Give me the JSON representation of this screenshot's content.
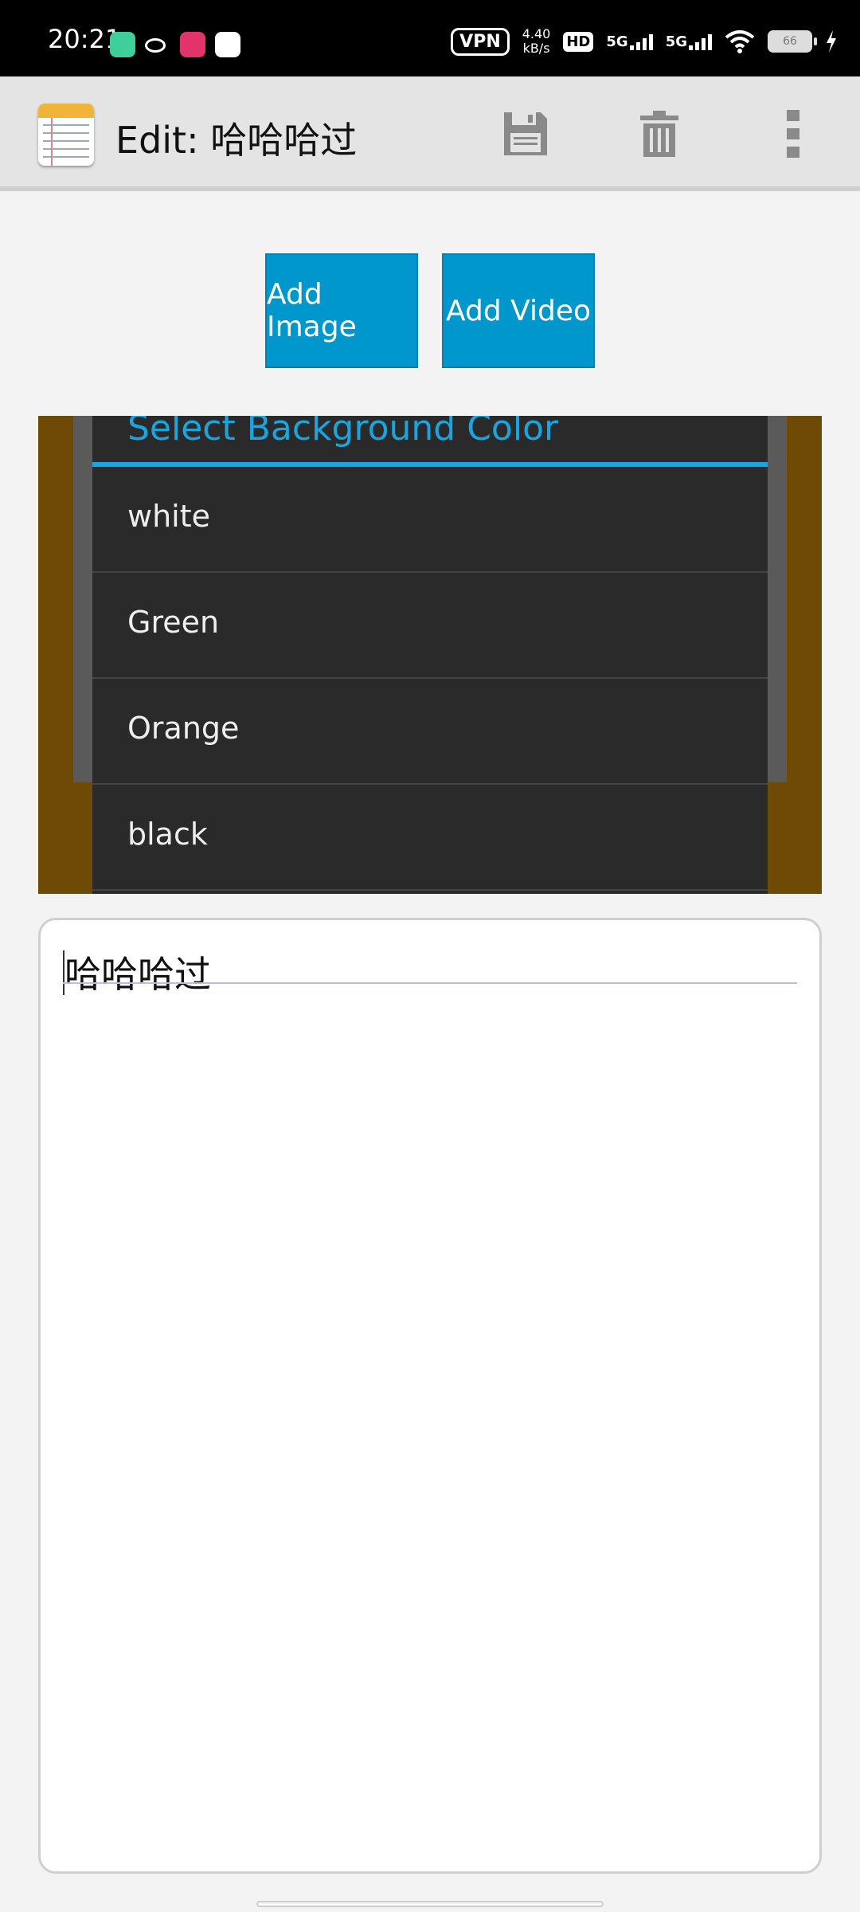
{
  "status_bar": {
    "time": "20:21",
    "vpn": "VPN",
    "net_speed_value": "4.40",
    "net_speed_unit": "kB/s",
    "hd": "HD",
    "network1": "5G",
    "network2": "5G",
    "battery": "66"
  },
  "action_bar": {
    "title": "Edit: 哈哈哈过",
    "icons": [
      "notepad-app-icon",
      "save-icon",
      "delete-icon",
      "overflow-menu-icon"
    ]
  },
  "buttons": {
    "add_image": "Add Image",
    "add_video": "Add Video"
  },
  "dialog": {
    "title": "Select Background Color",
    "options": [
      "white",
      "Green",
      "Orange",
      "black"
    ]
  },
  "editor": {
    "text": "哈哈哈过"
  },
  "colors": {
    "accent": "#0097cc",
    "dialog_bg": "#2a2a2a",
    "dialog_title": "#19a6e0",
    "image_bg": "#6e4a06"
  }
}
